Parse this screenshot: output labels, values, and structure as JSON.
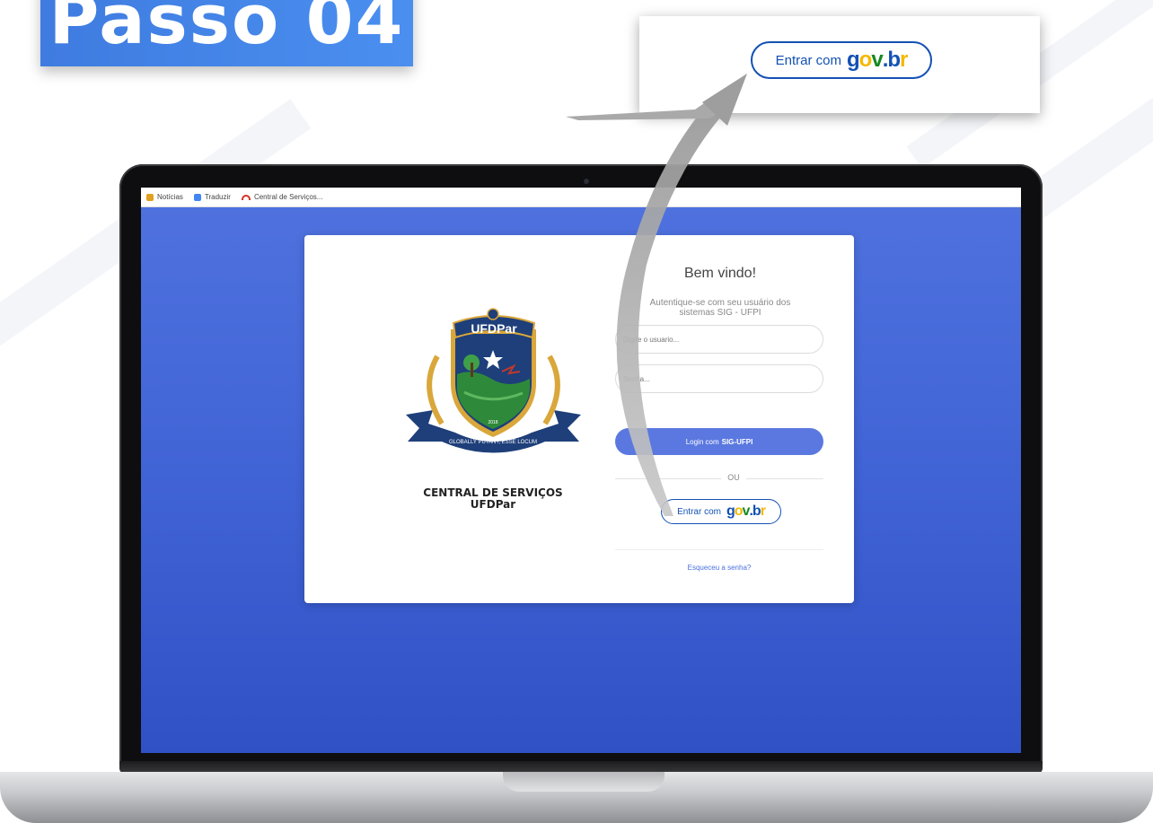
{
  "step_badge": {
    "label": "Passo 04"
  },
  "callout": {
    "button_label": "Entrar com",
    "logo": {
      "g": "g",
      "o": "o",
      "v": "v",
      "dot": ".",
      "b": "b",
      "r": "r"
    }
  },
  "browser": {
    "bookmarks": [
      {
        "label": "Notícias",
        "icon": "news-icon",
        "color": "#e0a020"
      },
      {
        "label": "Traduzir",
        "icon": "translate-icon",
        "color": "#4285f4"
      },
      {
        "label": "Central de Serviços...",
        "icon": "arc-icon",
        "color": "#d93025"
      }
    ]
  },
  "login": {
    "crest_text": "UFDPar",
    "crest_year": "2018",
    "crest_motto": "GLOBALLY PUTANT, ESSE LOCUM",
    "institution_line1": "CENTRAL DE SERVIÇOS",
    "institution_line2": "UFDPar",
    "welcome": "Bem vindo!",
    "subtitle_line1": "Autentique-se com seu usuário dos",
    "subtitle_line2": "sistemas SIG - UFPI",
    "username_placeholder": "Digite o usuario...",
    "password_placeholder": "Senha...",
    "sig_button_prefix": "Login com",
    "sig_button_bold": "SIG-UFPI",
    "or_label": "OU",
    "gov_button_label": "Entrar com",
    "forgot_link": "Esqueceu a senha?"
  },
  "colors": {
    "screen_bg": "#4467d8",
    "accent": "#5b78e0",
    "gov_blue": "#1351b4",
    "gov_yellow": "#f5b800",
    "gov_green": "#168821",
    "badge": "#3f7be0"
  }
}
